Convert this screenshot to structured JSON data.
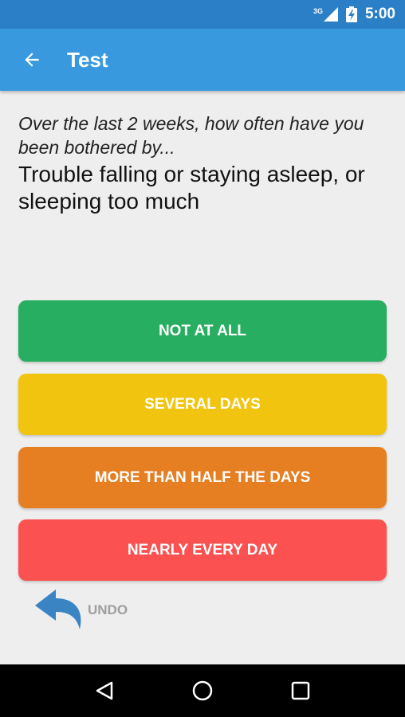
{
  "status_bar": {
    "network_label": "3G",
    "time": "5:00",
    "icons": [
      "signal-icon",
      "battery-icon"
    ]
  },
  "app_bar": {
    "title": "Test",
    "back_icon": "arrow-left-icon"
  },
  "question": {
    "prompt": "Over the last 2 weeks, how often have you been bothered by...",
    "text": "Trouble falling or staying asleep, or sleeping too much"
  },
  "answers": [
    {
      "label": "NOT AT ALL",
      "color": "#27ae60"
    },
    {
      "label": "SEVERAL DAYS",
      "color": "#f1c40f"
    },
    {
      "label": "MORE THAN HALF THE DAYS",
      "color": "#e67e22"
    },
    {
      "label": "NEARLY EVERY DAY",
      "color": "#fc5151"
    }
  ],
  "undo": {
    "label": "UNDO",
    "icon": "undo-arrow-icon",
    "icon_color": "#3a84c4"
  },
  "nav_bar": {
    "buttons": [
      "back-triangle-icon",
      "home-circle-icon",
      "recents-square-icon"
    ]
  }
}
